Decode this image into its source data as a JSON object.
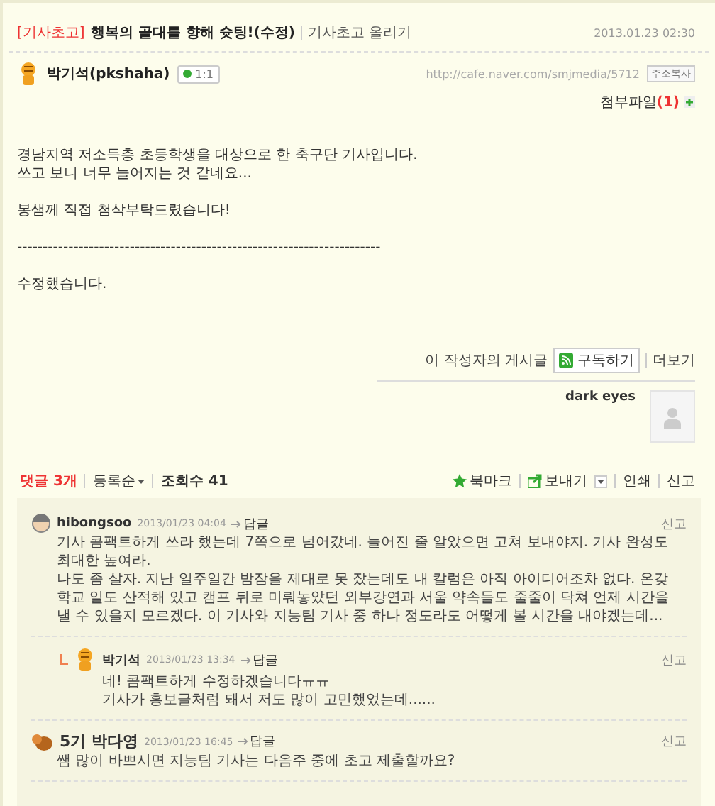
{
  "post": {
    "category": "[기사초고]",
    "title": "행복의 골대를 향해 슛팅!(수정)",
    "board": "기사초고 올리기",
    "date": "2013.01.23 02:30",
    "author": "박기석(pkshaha)",
    "chat_badge": "1:1",
    "url": "http://cafe.naver.com/smjmedia/5712",
    "copy_button": "주소복사",
    "attachment_label": "첨부파일",
    "attachment_count": "(1)",
    "body": [
      [
        "경남지역 저소득층 초등학생을 대상으로 한 축구단 기사입니다.",
        "쓰고 보니 너무 늘어지는 것 같네요..."
      ],
      [
        "봉샘께 직접 첨삭부탁드렸습니다!"
      ],
      [
        "-----------------------------------------------------------------------"
      ],
      [
        "수정했습니다."
      ]
    ],
    "author_posts_label": "이 작성자의 게시글",
    "subscribe_button": "구독하기",
    "more_link": "더보기",
    "profile_name": "dark eyes"
  },
  "toolbar": {
    "comments": "댓글 3개",
    "sort": "등록순",
    "views": "조회수 41",
    "actions": [
      {
        "label": "북마크",
        "kind": "star"
      },
      {
        "label": "보내기",
        "kind": "send"
      },
      {
        "label": "인쇄",
        "kind": "plain"
      },
      {
        "label": "신고",
        "kind": "plain"
      }
    ]
  },
  "comments": [
    {
      "author": "hibongsoo",
      "date": "2013/01/23 04:04",
      "reply": "답글",
      "report": "신고",
      "kind": "top",
      "big": false,
      "lines": [
        "기사 콤팩트하게 쓰라 했는데 7쪽으로 넘어갔네. 늘어진 줄 알았으면 고쳐 보내야지. 기사 완성도 최대한 높여라.",
        "나도 좀 살자. 지난 일주일간 밤잠을 제대로 못 잤는데도 내 칼럼은 아직 아이디어조차 없다. 온갖 학교 일도 산적해 있고 캠프 뒤로 미뤄놓았던 외부강연과 서울 약속들도 줄줄이 닥쳐 언제 시간을 낼 수 있을지 모르겠다. 이 기사와 지능팀 기사 중 하나 정도라도 어떻게 볼 시간을 내야겠는데..."
      ]
    },
    {
      "author": "박기석",
      "date": "2013/01/23 13:34",
      "reply": "답글",
      "report": "신고",
      "kind": "reply",
      "big": false,
      "lines": [
        "네! 콤팩트하게 수정하겠습니다ㅠㅠ",
        "기사가 홍보글처럼 돼서 저도 많이 고민했었는데......"
      ]
    },
    {
      "author": "5기 박다영",
      "date": "2013/01/23 16:45",
      "reply": "답글",
      "report": "신고",
      "kind": "top",
      "big": true,
      "lines": [
        "쌤 많이 바쁘시면 지능팀 기사는 다음주 중에 초고 제출할까요?"
      ]
    }
  ]
}
